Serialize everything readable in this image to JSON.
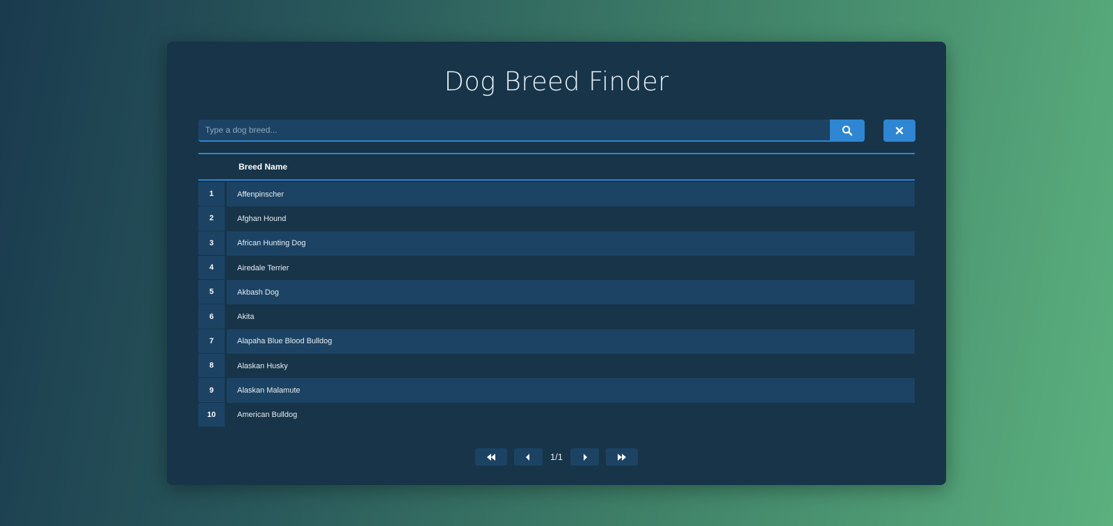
{
  "title": "Dog Breed Finder",
  "search": {
    "placeholder": "Type a dog breed...",
    "value": ""
  },
  "table": {
    "header": "Breed Name",
    "rows": [
      {
        "num": "1",
        "name": "Affenpinscher"
      },
      {
        "num": "2",
        "name": "Afghan Hound"
      },
      {
        "num": "3",
        "name": "African Hunting Dog"
      },
      {
        "num": "4",
        "name": "Airedale Terrier"
      },
      {
        "num": "5",
        "name": "Akbash Dog"
      },
      {
        "num": "6",
        "name": "Akita"
      },
      {
        "num": "7",
        "name": "Alapaha Blue Blood Bulldog"
      },
      {
        "num": "8",
        "name": "Alaskan Husky"
      },
      {
        "num": "9",
        "name": "Alaskan Malamute"
      },
      {
        "num": "10",
        "name": "American Bulldog"
      }
    ]
  },
  "pager": {
    "page_text": "1/1"
  },
  "icons": {
    "search": "search-icon",
    "clear": "close-icon",
    "first": "double-chevron-left-icon",
    "prev": "chevron-left-icon",
    "next": "chevron-right-icon",
    "last": "double-chevron-right-icon"
  },
  "colors": {
    "accent": "#2f86d3",
    "card": "#173449",
    "row_alt": "#1c4364"
  }
}
